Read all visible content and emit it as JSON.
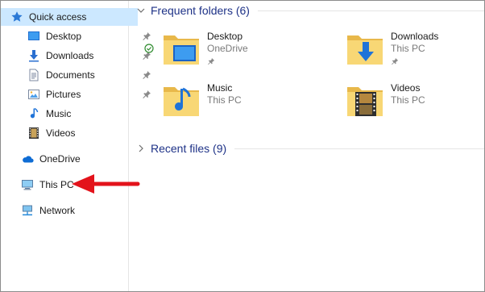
{
  "nav": {
    "quick_access": "Quick access",
    "pinned": [
      {
        "label": "Desktop",
        "icon": "desktop-icon",
        "pinned": true
      },
      {
        "label": "Downloads",
        "icon": "downloads-icon",
        "pinned": true
      },
      {
        "label": "Documents",
        "icon": "documents-icon",
        "pinned": true
      },
      {
        "label": "Pictures",
        "icon": "pictures-icon",
        "pinned": true
      },
      {
        "label": "Music",
        "icon": "music-icon",
        "pinned": false
      },
      {
        "label": "Videos",
        "icon": "videos-icon",
        "pinned": false
      }
    ],
    "onedrive": "OneDrive",
    "this_pc": "This PC",
    "network": "Network"
  },
  "content": {
    "frequent_header": "Frequent folders (6)",
    "recent_header": "Recent files (9)",
    "folders": [
      {
        "name": "Desktop",
        "location": "OneDrive",
        "pinned": true,
        "synced": true,
        "overlay": "desktop-icon"
      },
      {
        "name": "Downloads",
        "location": "This PC",
        "pinned": true,
        "synced": false,
        "overlay": "download-arrow-icon"
      },
      {
        "name": "Music",
        "location": "This PC",
        "pinned": false,
        "synced": false,
        "overlay": "music-note-icon"
      },
      {
        "name": "Videos",
        "location": "This PC",
        "pinned": false,
        "synced": false,
        "overlay": "film-strip-icon"
      }
    ]
  },
  "annotation": {
    "color": "#e3131b",
    "points_to": "This PC"
  },
  "colors": {
    "selected_bg": "#cce8ff",
    "group_title": "#1e3287",
    "folder": "#f8d775"
  }
}
